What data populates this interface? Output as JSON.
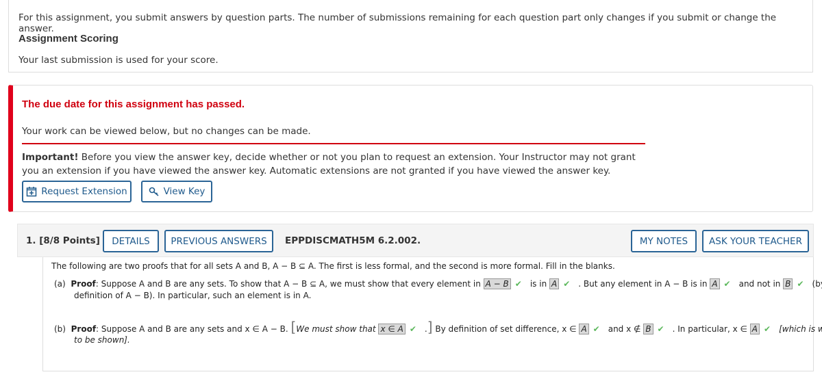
{
  "submission": {
    "intro": "For this assignment, you submit answers by question parts. The number of submissions remaining for each question part only changes if you submit or change the answer.",
    "scoring_heading": "Assignment Scoring",
    "scoring_text": "Your last submission is used for your score."
  },
  "notice": {
    "due": "The due date for this assignment has passed.",
    "work": "Your work can be viewed below, but no changes can be made.",
    "important_label": "Important!",
    "important_text": " Before you view the answer key, decide whether or not you plan to request an extension. Your Instructor may not grant you an extension if you have viewed the answer key. Automatic extensions are not granted if you have viewed the answer key.",
    "request_extension": "Request Extension",
    "view_key": "View Key"
  },
  "question": {
    "number": "1.  [8/8 Points]",
    "details": "DETAILS",
    "previous_answers": "PREVIOUS ANSWERS",
    "code": "EPPDISCMATH5M 6.2.002.",
    "my_notes": "MY NOTES",
    "ask_teacher": "ASK YOUR TEACHER",
    "intro": "The following are two proofs that for all sets A and B, A − B ⊆ A. The first is less formal, and the second is more formal. Fill in the blanks.",
    "a": {
      "label": "(a)",
      "proof": "Proof",
      "t1": ": Suppose A and B are any sets. To show that A − B ⊆ A, we must show that every element in",
      "ans1": "A − B",
      "t2": "is in",
      "ans2": "A",
      "t3": ". But any element in A − B is in",
      "ans3": "A",
      "t4": "and not in",
      "ans4": "B",
      "t5": "(by",
      "t6": "definition of A − B). In particular, such an element is in A."
    },
    "b": {
      "label": "(b)",
      "proof": "Proof",
      "t1": ": Suppose A and B are any sets and x ∈ A − B.",
      "t2": "We must show that",
      "ans1": "x ∈ A",
      "t3": "By definition of set difference, x ∈",
      "ans2": "A",
      "t4": "and x ∉",
      "ans3": "B",
      "t5": ". In particular, x ∈",
      "ans4": "A",
      "t6": "[which is what was",
      "t7": "to be shown]."
    }
  },
  "colors": {
    "accent": "#1f5a8c",
    "alert": "#d0000f",
    "correct": "#5cb85c"
  }
}
